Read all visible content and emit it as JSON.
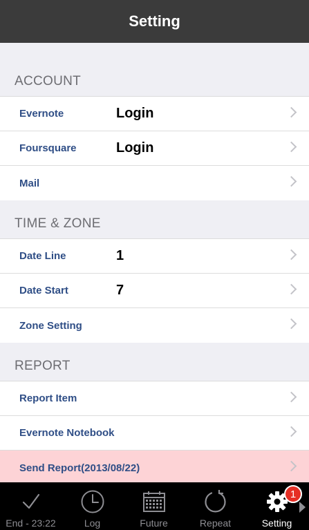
{
  "navbar": {
    "title": "Setting"
  },
  "sections": {
    "account": {
      "header": "ACCOUNT",
      "rows": [
        {
          "label": "Evernote",
          "value": "Login"
        },
        {
          "label": "Foursquare",
          "value": "Login"
        },
        {
          "label": "Mail",
          "value": ""
        }
      ]
    },
    "time_zone": {
      "header": "TIME & ZONE",
      "rows": [
        {
          "label": "Date Line",
          "value": "1"
        },
        {
          "label": "Date Start",
          "value": "7"
        },
        {
          "label": "Zone Setting",
          "value": ""
        }
      ]
    },
    "report": {
      "header": "REPORT",
      "rows": [
        {
          "label": "Report Item",
          "value": ""
        },
        {
          "label": "Evernote Notebook",
          "value": ""
        },
        {
          "label": "Send Report(2013/08/22)",
          "value": ""
        }
      ]
    }
  },
  "tabbar": {
    "tabs": [
      {
        "label": "End - 23:22",
        "icon": "checkmark-icon"
      },
      {
        "label": "Log",
        "icon": "clock-icon"
      },
      {
        "label": "Future",
        "icon": "calendar-icon"
      },
      {
        "label": "Repeat",
        "icon": "repeat-icon"
      },
      {
        "label": "Setting",
        "icon": "gear-icon",
        "badge": "1",
        "active": true
      }
    ]
  },
  "colors": {
    "navbar_bg": "#3b3b3b",
    "label_blue": "#2f4e86",
    "highlight_row": "#fdd3d6",
    "badge_red": "#e62f25"
  }
}
